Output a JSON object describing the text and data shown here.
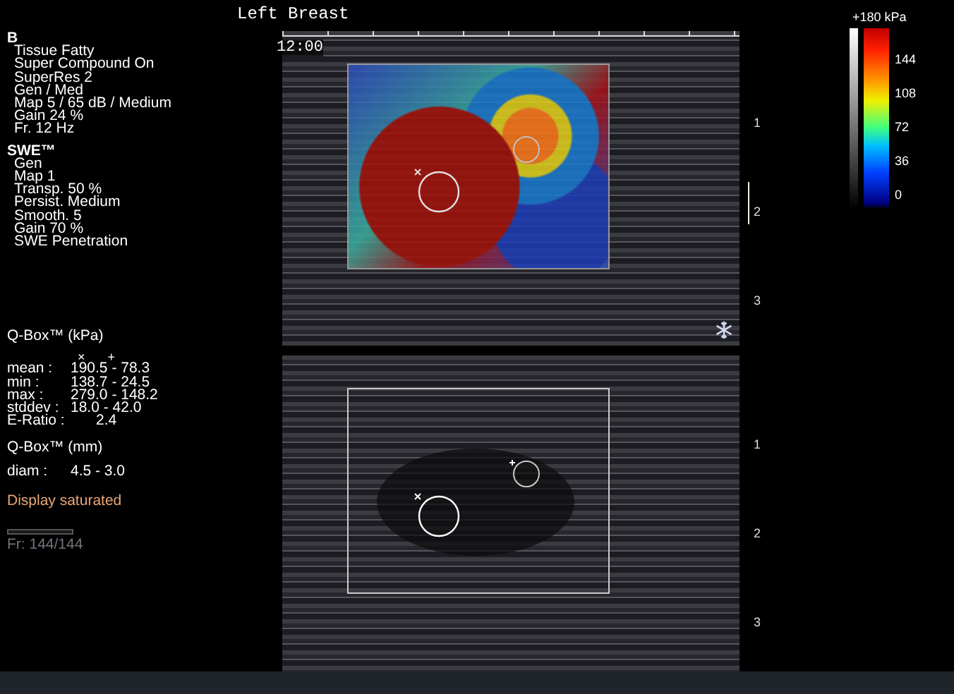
{
  "header": {
    "title": "Left Breast",
    "clock": "12:00"
  },
  "b_mode": {
    "heading": "B",
    "settings": [
      "Tissue Fatty",
      "Super Compound On",
      "SuperRes 2",
      "Gen / Med",
      "Map 5 / 65 dB / Medium",
      "Gain 24 %",
      "Fr. 12 Hz"
    ]
  },
  "swe": {
    "heading": "SWE™",
    "settings": [
      "Gen",
      "Map 1",
      "Transp. 50 %",
      "Persist. Medium",
      "Smooth. 5",
      "Gain 70 %",
      "SWE Penetration"
    ]
  },
  "qbox_kpa": {
    "heading": "Q-Box™ (kPa)",
    "markers": [
      "×",
      "+"
    ],
    "rows": [
      {
        "label": "mean :",
        "value": "190.5 - 78.3"
      },
      {
        "label": "min :",
        "value": "138.7 - 24.5"
      },
      {
        "label": "max :",
        "value": "279.0 - 148.2"
      },
      {
        "label": "stddev :",
        "value": "18.0 - 42.0"
      },
      {
        "label": "E-Ratio :",
        "value": "2.4"
      }
    ]
  },
  "qbox_mm": {
    "heading": "Q-Box™ (mm)",
    "rows": [
      {
        "label": "diam :",
        "value": "4.5 - 3.0"
      }
    ]
  },
  "warning": "Display saturated",
  "frame": {
    "counter": "Fr: 144/144",
    "level": 1
  },
  "color_scale": {
    "max_label": "+180 kPa",
    "ticks": [
      "144",
      "108",
      "72",
      "36",
      "0"
    ]
  },
  "top_depth_ticks": [
    "1",
    "2",
    "3"
  ],
  "bottom_depth_ticks": [
    "1",
    "2",
    "3"
  ]
}
